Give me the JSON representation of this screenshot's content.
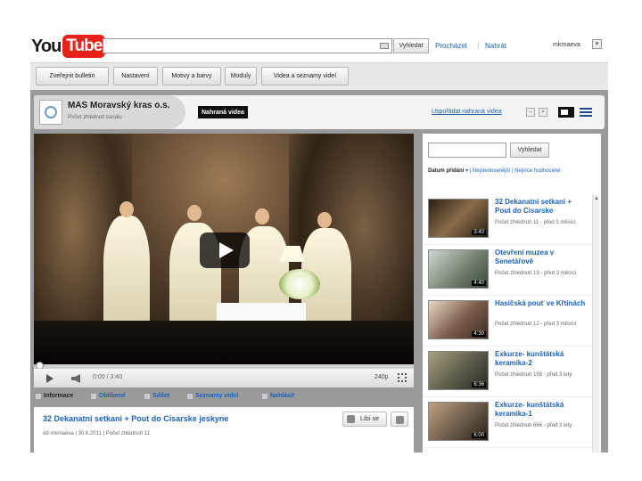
{
  "topbar": {
    "logo_you": "You",
    "logo_tube": "Tube",
    "search_button": "Vyhledat",
    "nav_browse": "Procházet",
    "nav_upload": "Nahrát",
    "username": "mkrnaeva"
  },
  "tabs": [
    "Zveřejnit bulletin",
    "Nastavení",
    "Motivy a barvy",
    "Moduly",
    "Videa a seznamy videí"
  ],
  "channel": {
    "name": "MAS Moravský kras o.s.",
    "subtitle": "Počet zhlédnutí kanálu",
    "uploaded_label": "Nahraná videa",
    "sort_link": "Uspořádat nahraná videa"
  },
  "player": {
    "time": "0:00 / 3:40",
    "quality": "240p"
  },
  "info_tabs": [
    "Informace",
    "Oblíbené",
    "Sdílet",
    "Seznamy videí",
    "Nahlásit"
  ],
  "video": {
    "title": "32 Dekanatni setkani + Pout do Cisarske jeskyne",
    "meta": "od mkrnaeva | 30.6.2011 | Počet zhlédnutí 11",
    "like_label": "Líbí se"
  },
  "sidebar": {
    "search_button": "Vyhledat",
    "sort_active": "Datum přidání",
    "sort_options": "| Nejsledovanější | Nejvíce hodnocené",
    "items": [
      {
        "title": "32 Dekanatni setkani + Pout do Cisarske",
        "meta": "Počet zhlédnutí 11 - před 3 měsíci",
        "duration": "3:40",
        "thumb_color": "#4a3a2a"
      },
      {
        "title": "Otevření muzea v Senetářově",
        "meta": "Počet zhlédnutí 13 - před 3 měsíci",
        "duration": "4:40",
        "thumb_color": "#6f7a6a"
      },
      {
        "title": "Hasičská pouť ve Křtinách",
        "meta": "Počet zhlédnutí 12 - před 3 měsíci",
        "duration": "4:30",
        "thumb_color": "#7a5a4a"
      },
      {
        "title": "Exkurze- kunštátská keramika-2",
        "meta": "Počet zhlédnutí 158 - před 3 lety",
        "duration": "6:36",
        "thumb_color": "#5a5a4a"
      },
      {
        "title": "Exkurze- kunštátská keramika-1",
        "meta": "Počet zhlédnutí 666 - před 3 lety",
        "duration": "6:00",
        "thumb_color": "#6a5a4a"
      }
    ]
  }
}
